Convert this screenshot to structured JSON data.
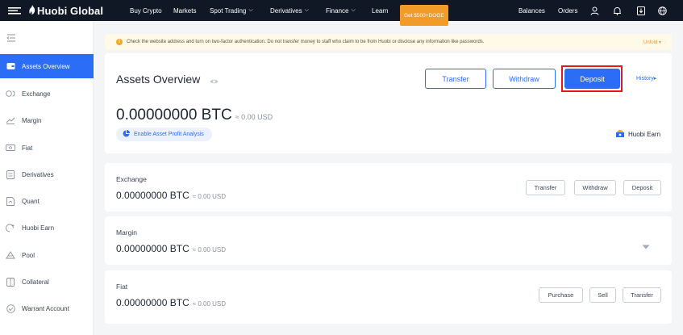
{
  "topnav": {
    "logo": "Huobi Global",
    "items": [
      {
        "label": "Buy Crypto",
        "has_dropdown": false
      },
      {
        "label": "Markets",
        "has_dropdown": false
      },
      {
        "label": "Spot Trading",
        "has_dropdown": true
      },
      {
        "label": "Derivatives",
        "has_dropdown": true
      },
      {
        "label": "Finance",
        "has_dropdown": true
      },
      {
        "label": "Learn",
        "has_dropdown": false
      }
    ],
    "promo": "Get $500+DOGE",
    "balances": "Balances",
    "orders": "Orders",
    "icons": [
      "user-icon",
      "bell-icon",
      "download-icon",
      "globe-icon"
    ]
  },
  "sidebar": {
    "items": [
      {
        "label": "Assets Overview",
        "icon": "wallet-icon",
        "active": true
      },
      {
        "label": "Exchange",
        "icon": "exchange-icon",
        "active": false
      },
      {
        "label": "Margin",
        "icon": "margin-icon",
        "active": false
      },
      {
        "label": "Fiat",
        "icon": "fiat-icon",
        "active": false
      },
      {
        "label": "Derivatives",
        "icon": "derivatives-icon",
        "active": false
      },
      {
        "label": "Quant",
        "icon": "quant-icon",
        "active": false
      },
      {
        "label": "Huobi Earn",
        "icon": "earn-icon",
        "active": false
      },
      {
        "label": "Pool",
        "icon": "pool-icon",
        "active": false
      },
      {
        "label": "Collateral",
        "icon": "collateral-icon",
        "active": false
      },
      {
        "label": "Warrant Account",
        "icon": "warrant-icon",
        "active": false
      }
    ]
  },
  "notice": {
    "text": "Check the website address and turn on two-factor authentication. Do not transfer money to staff who claim to be from Huobi or disclose any information like passwords.",
    "unfold": "Unfold"
  },
  "overview": {
    "title": "Assets Overview",
    "transfer": "Transfer",
    "withdraw": "Withdraw",
    "deposit": "Deposit",
    "history": "History",
    "balance": "0.00000000 BTC",
    "usd": "≈ 0.00 USD",
    "profit_analysis": "Enable Asset Profit Analysis",
    "huobi_earn": "Huobi Earn"
  },
  "accounts": [
    {
      "name": "Exchange",
      "balance": "0.00000000 BTC",
      "usd": "≈ 0.00 USD",
      "buttons": [
        "Transfer",
        "Withdraw",
        "Deposit"
      ]
    },
    {
      "name": "Margin",
      "balance": "0.00000000 BTC",
      "usd": "≈ 0.00 USD",
      "buttons": []
    },
    {
      "name": "Fiat",
      "balance": "0.00000000 BTC",
      "usd": "≈ 0.00 USD",
      "buttons": [
        "Purchase",
        "Sell",
        "Transfer"
      ]
    }
  ],
  "colors": {
    "accent": "#2b6ef5",
    "nav_bg": "#101725",
    "promo": "#f29b29",
    "highlight": "#e0181f",
    "notice_bg": "#fff9e8"
  }
}
